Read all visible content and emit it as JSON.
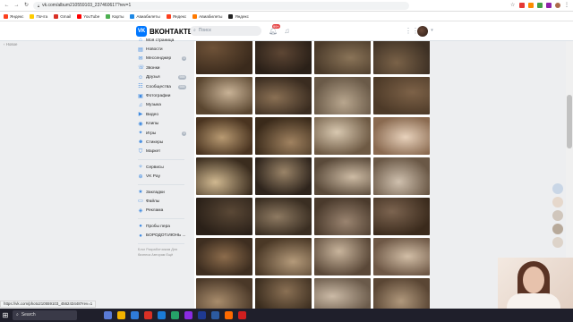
{
  "browser": {
    "url": "vk.com/album210559103_237460617?rev=1",
    "bookmarks": [
      "Яндекс",
      "Почта",
      "Gmail",
      "YouTube",
      "Карты",
      "Авиабилеты",
      "Яндекс",
      "Авиабилеты",
      "Яндекс"
    ],
    "bookmark_colors": [
      "#fc3f1d",
      "#ffcc00",
      "#d93025",
      "#ff0000",
      "#4caf50",
      "#1e88e5",
      "#fc3f1d",
      "#ff7a00",
      "#222222"
    ],
    "status_url": "https://vk.com/photo210559103_456243448?rev=1"
  },
  "left_note": "Новое",
  "header": {
    "logo": "ВКОНТАКТЕ",
    "logo_mark": "VK",
    "search_placeholder": "Поиск",
    "notif_badge": "99+"
  },
  "sidebar": {
    "items": [
      {
        "label": "Моя страница",
        "icon": "home-icon",
        "glyph": "⌂",
        "count": ""
      },
      {
        "label": "Новости",
        "icon": "news-icon",
        "glyph": "▤",
        "count": ""
      },
      {
        "label": "Мессенджер",
        "icon": "messenger-icon",
        "glyph": "✉",
        "count": "3"
      },
      {
        "label": "Звонки",
        "icon": "phone-icon",
        "glyph": "☏",
        "count": ""
      },
      {
        "label": "Друзья",
        "icon": "friends-icon",
        "glyph": "☺",
        "count": "555"
      },
      {
        "label": "Сообщества",
        "icon": "communities-icon",
        "glyph": "☷",
        "count": "555"
      },
      {
        "label": "Фотографии",
        "icon": "photo-icon",
        "glyph": "▣",
        "count": ""
      },
      {
        "label": "Музыка",
        "icon": "music-icon",
        "glyph": "♫",
        "count": ""
      },
      {
        "label": "Видео",
        "icon": "video-icon",
        "glyph": "▶",
        "count": ""
      },
      {
        "label": "Клипы",
        "icon": "clips-icon",
        "glyph": "◉",
        "count": ""
      },
      {
        "label": "Игры",
        "icon": "games-icon",
        "glyph": "✦",
        "count": "3"
      },
      {
        "label": "Стикеры",
        "icon": "stickers-icon",
        "glyph": "☻",
        "count": ""
      },
      {
        "label": "Маркет",
        "icon": "market-icon",
        "glyph": "⛉",
        "count": ""
      }
    ],
    "items2": [
      {
        "label": "Сервисы",
        "icon": "services-icon",
        "glyph": "✧"
      },
      {
        "label": "VK Pay",
        "icon": "vkpay-icon",
        "glyph": "⊕"
      }
    ],
    "items3": [
      {
        "label": "Закладки",
        "icon": "bookmarks-icon",
        "glyph": "★"
      },
      {
        "label": "Файлы",
        "icon": "files-icon",
        "glyph": "▭"
      },
      {
        "label": "Реклама",
        "icon": "ads-icon",
        "glyph": "◈"
      }
    ],
    "items4": [
      {
        "label": "Пробы пера",
        "icon": "community-icon",
        "glyph": "●"
      },
      {
        "label": "БОРОДОТ.ИЮНЬ ...",
        "icon": "community-icon",
        "glyph": "●"
      }
    ],
    "footer": "Блог  Разработчикам  Для бизнеса  Авторам  Ещё"
  },
  "photos": {
    "colors": [
      [
        "#3a2a1c",
        "#6e5238"
      ],
      [
        "#2a2018",
        "#5d4634"
      ],
      [
        "#4a3a2a",
        "#8a7458"
      ],
      [
        "#3d3024",
        "#7a6248"
      ],
      [
        "#5a4630",
        "#c8b296"
      ],
      [
        "#3a2c20",
        "#8a7054"
      ],
      [
        "#6a5a48",
        "#b8a68e"
      ],
      [
        "#4d3a28",
        "#7d6248"
      ],
      [
        "#4a3420",
        "#b89a72"
      ],
      [
        "#3a2a1a",
        "#a08260"
      ],
      [
        "#6e5a44",
        "#d8c8b0"
      ],
      [
        "#8a6a50",
        "#e8d2bc"
      ],
      [
        "#3a2c1e",
        "#d0b890"
      ],
      [
        "#2e241c",
        "#9a8468"
      ],
      [
        "#5a4a3a",
        "#cdbba4"
      ],
      [
        "#6a5846",
        "#cfc0ae"
      ],
      [
        "#2a2018",
        "#5a4836"
      ],
      [
        "#3a2e22",
        "#8e7a62"
      ],
      [
        "#4a3a2c",
        "#9a8470"
      ],
      [
        "#3a2a1c",
        "#7c6450"
      ],
      [
        "#3e2e20",
        "#8c6c4c"
      ],
      [
        "#4a3826",
        "#b49a7a"
      ],
      [
        "#5a4838",
        "#c8b49c"
      ],
      [
        "#6e5846",
        "#d2bea6"
      ],
      [
        "#4a3828",
        "#a88c6c"
      ],
      [
        "#3a2c1e",
        "#8a7054"
      ],
      [
        "#6a5a4a",
        "#cbbaa6"
      ],
      [
        "#5a4634",
        "#b0987c"
      ]
    ]
  }
}
